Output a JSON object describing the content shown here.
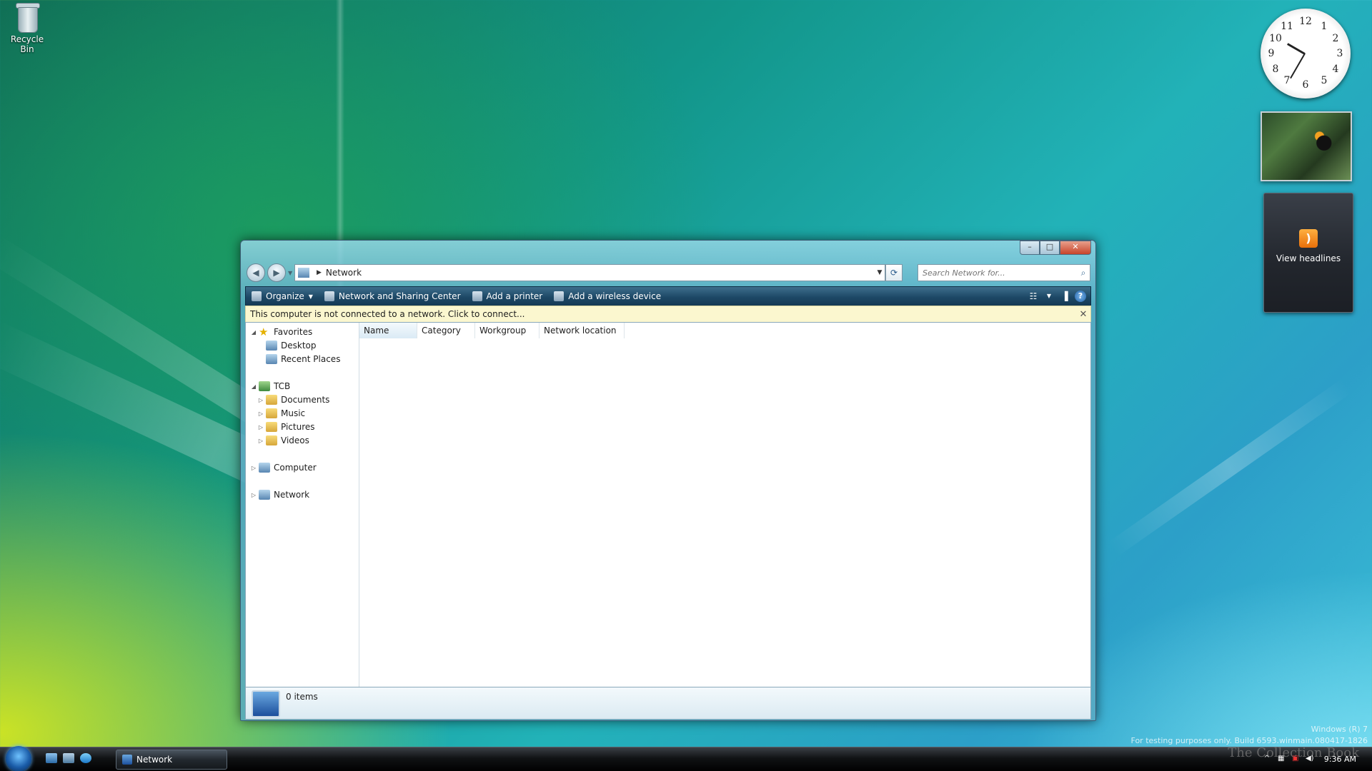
{
  "desktop": {
    "icons": [
      {
        "label": "Recycle Bin",
        "icon": "recycle-bin-icon"
      }
    ]
  },
  "gadgets": {
    "clock_numbers": [
      "12",
      "1",
      "2",
      "3",
      "4",
      "5",
      "6",
      "7",
      "8",
      "9",
      "10",
      "11"
    ],
    "feed_label": "View headlines"
  },
  "window": {
    "address": {
      "location": "Network"
    },
    "search": {
      "placeholder": "Search Network for..."
    },
    "toolbar": {
      "organize": "Organize",
      "network_sharing": "Network and Sharing Center",
      "add_printer": "Add a printer",
      "add_wireless": "Add a wireless device"
    },
    "infobar": {
      "message": "This computer is not connected to a network. Click to connect..."
    },
    "nav_tree": [
      {
        "label": "Favorites",
        "level": 0,
        "expanded": true,
        "icon": "star-icon"
      },
      {
        "label": "Desktop",
        "level": 1,
        "icon": "desktop-icon"
      },
      {
        "label": "Recent Places",
        "level": 1,
        "icon": "recent-places-icon"
      },
      {
        "label": "TCB",
        "level": 0,
        "expanded": true,
        "icon": "user-folder-icon"
      },
      {
        "label": "Documents",
        "level": 1,
        "icon": "documents-folder-icon"
      },
      {
        "label": "Music",
        "level": 1,
        "icon": "music-folder-icon"
      },
      {
        "label": "Pictures",
        "level": 1,
        "icon": "pictures-folder-icon"
      },
      {
        "label": "Videos",
        "level": 1,
        "icon": "videos-folder-icon"
      },
      {
        "label": "Computer",
        "level": 0,
        "icon": "computer-icon"
      },
      {
        "label": "Network",
        "level": 0,
        "icon": "network-icon"
      }
    ],
    "columns": [
      "Name",
      "Category",
      "Workgroup",
      "Network location"
    ],
    "details": {
      "count": "0 items"
    }
  },
  "taskbar": {
    "task": "Network",
    "time": "9:36 AM"
  },
  "watermark": {
    "line1": "Windows (R) 7",
    "line2": "For testing purposes only. Build 6593.winmain.080417-1826",
    "brand": "The Collection Book"
  },
  "colors": {
    "toolbar": "#1d4866",
    "infobar": "#fbf7cf",
    "close_button": "#c8442a"
  }
}
